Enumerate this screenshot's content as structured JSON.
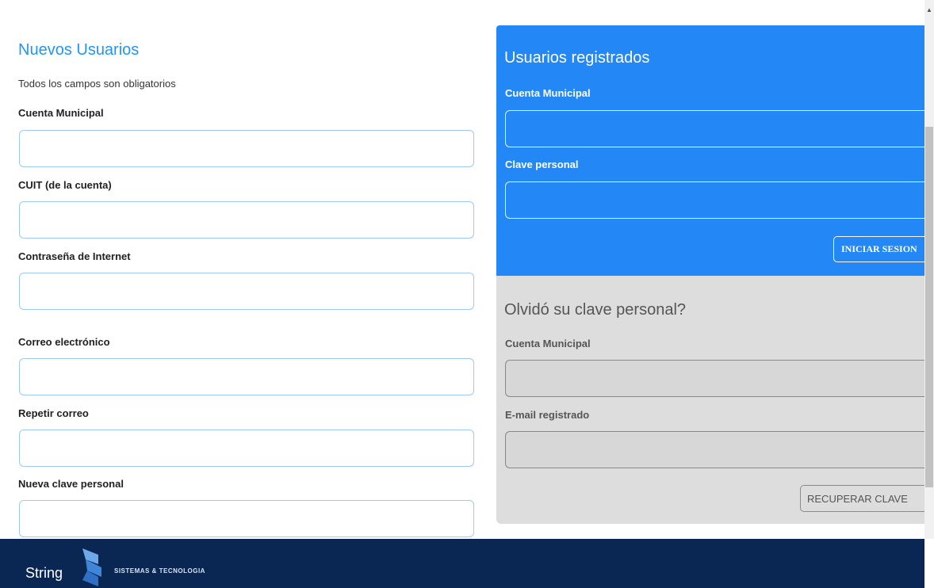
{
  "new_users": {
    "title": "Nuevos Usuarios",
    "subtitle": "Todos los campos son obligatorios",
    "fields": [
      {
        "label": "Cuenta Municipal",
        "value": ""
      },
      {
        "label": "CUIT (de la cuenta)",
        "value": ""
      },
      {
        "label": "Contraseña de Internet",
        "value": ""
      },
      {
        "label": "Correo electrónico",
        "value": ""
      },
      {
        "label": "Repetir correo",
        "value": ""
      },
      {
        "label": "Nueva clave personal",
        "value": ""
      }
    ]
  },
  "registered": {
    "title": "Usuarios registrados",
    "fields": [
      {
        "label": "Cuenta Municipal",
        "value": ""
      },
      {
        "label": "Clave personal",
        "value": ""
      }
    ],
    "login_button": "INICIAR SESION",
    "color": "#2388f6"
  },
  "forgot": {
    "title": "Olvidó su clave personal?",
    "fields": [
      {
        "label": "Cuenta Municipal",
        "value": ""
      },
      {
        "label": "E-mail registrado",
        "value": ""
      }
    ],
    "recover_button": "RECUPERAR CLAVE"
  },
  "footer": {
    "brand": "String",
    "tagline": "SISTEMAS & TECNOLOGIA",
    "color": "#0a2754"
  },
  "icons": {
    "logo": "string-s-logo-icon",
    "scroll_up": "chevron-up-icon"
  }
}
